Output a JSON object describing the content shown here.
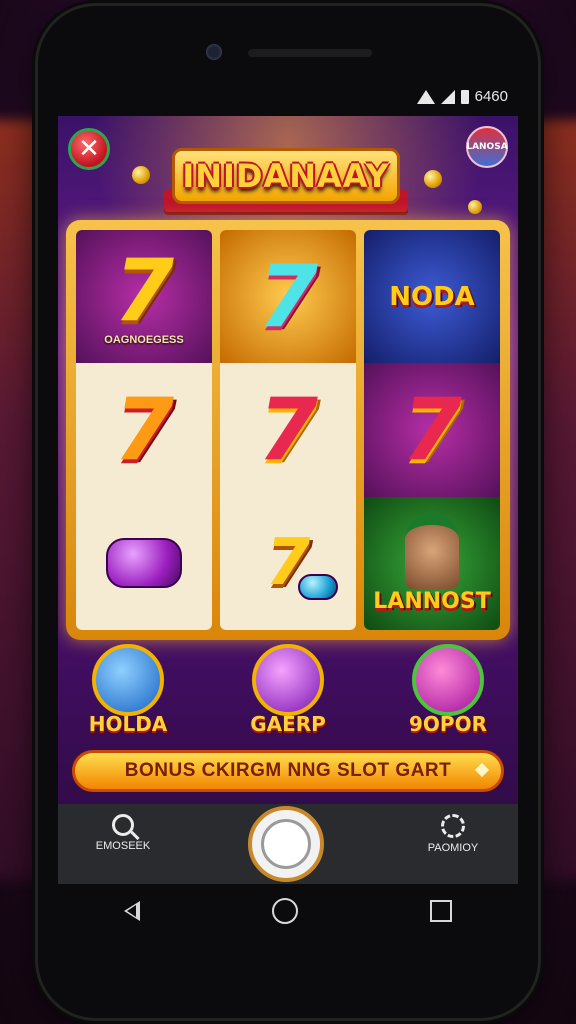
{
  "status_bar": {
    "time": "6460"
  },
  "header": {
    "title": "INIDANAAY",
    "badge_text": "LANOSA"
  },
  "reels": [
    {
      "cells": [
        {
          "type": "seven",
          "color": "gold",
          "label": "OAGNOEGESS"
        },
        {
          "type": "seven",
          "color": "orange"
        },
        {
          "type": "gem",
          "name": "purple-gem"
        }
      ]
    },
    {
      "cells": [
        {
          "type": "seven",
          "color": "cyan"
        },
        {
          "type": "seven",
          "color": "red"
        },
        {
          "type": "seven",
          "color": "gold"
        }
      ]
    },
    {
      "cells": [
        {
          "type": "word",
          "text": "NODA"
        },
        {
          "type": "seven",
          "color": "red"
        },
        {
          "type": "word",
          "text": "LANNOST"
        }
      ]
    }
  ],
  "medals": [
    {
      "label": "HOLDA",
      "color": "blue"
    },
    {
      "label": "GAERP",
      "color": "purple"
    },
    {
      "label": "9OPOR",
      "color": "green"
    }
  ],
  "cta": {
    "label": "BONUS CKIRGM NNG SLOT GART"
  },
  "bottom_bar": {
    "search_label": "EMOSEEK",
    "settings_label": "PAOMIOY"
  },
  "colors": {
    "gold": "#ffcc1a",
    "cta_bg": "#f28500",
    "background": "#3b1268",
    "bottom_bar": "#2a2b2f"
  }
}
